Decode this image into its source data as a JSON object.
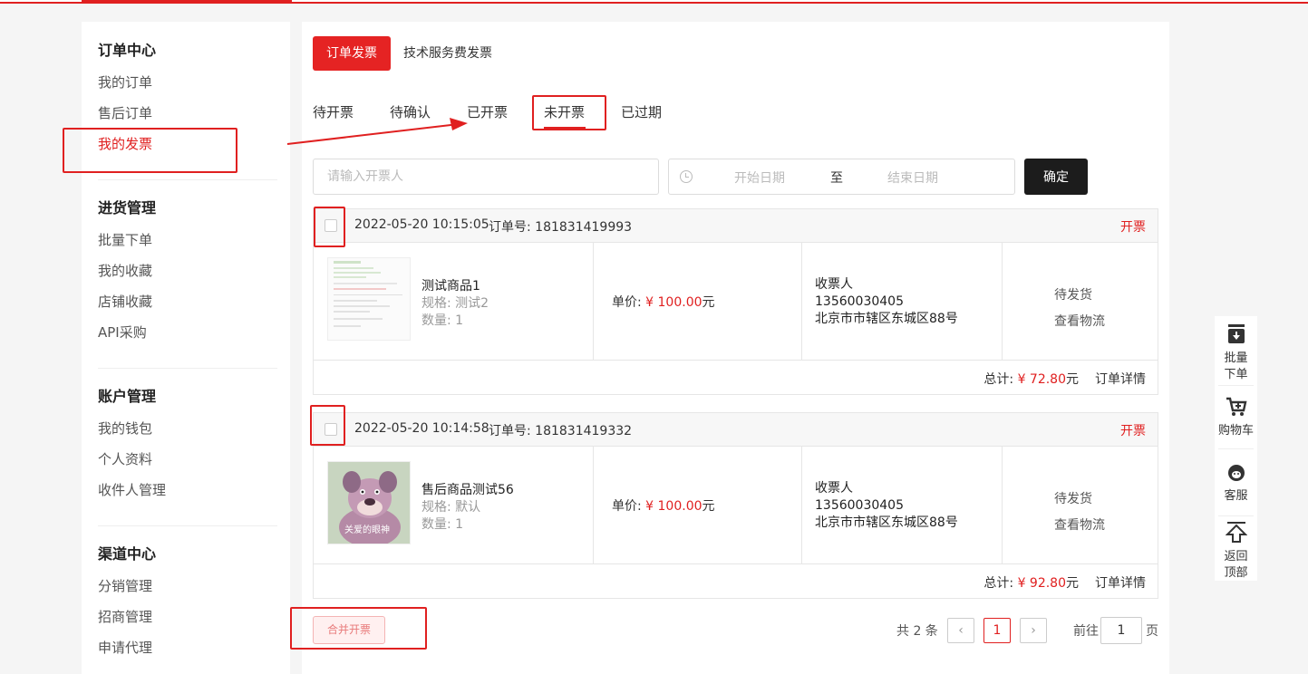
{
  "sidebar": {
    "groups": [
      {
        "title": "订单中心",
        "items": [
          "我的订单",
          "售后订单",
          "我的发票"
        ]
      },
      {
        "title": "进货管理",
        "items": [
          "批量下单",
          "我的收藏",
          "店铺收藏",
          "API采购"
        ]
      },
      {
        "title": "账户管理",
        "items": [
          "我的钱包",
          "个人资料",
          "收件人管理"
        ]
      },
      {
        "title": "渠道中心",
        "items": [
          "分销管理",
          "招商管理",
          "申请代理"
        ]
      }
    ]
  },
  "invoice_tabs": {
    "active": "订单发票",
    "other": "技术服务费发票"
  },
  "status_tabs": [
    "待开票",
    "待确认",
    "已开票",
    "未开票",
    "已过期"
  ],
  "filter": {
    "search_placeholder": "请输入开票人",
    "start_placeholder": "开始日期",
    "range_sep": "至",
    "end_placeholder": "结束日期",
    "confirm_label": "确定"
  },
  "orders": [
    {
      "date": "2022-05-20 10:15:05",
      "order_no": "订单号: 181831419993",
      "action": "开票",
      "product_name": "测试商品1",
      "spec": "规格: 测试2",
      "qty": "数量: 1",
      "unit_price_label": "单价:",
      "unit_price": "¥ 100.00",
      "unit_price_unit": "元",
      "receiver_title": "收票人",
      "receiver_phone": "13560030405",
      "receiver_addr": "北京市市辖区东城区88号",
      "ship_status": "待发货",
      "logistics": "查看物流",
      "total_label": "总计:",
      "total": "¥ 72.80",
      "total_unit": "元",
      "detail": "订单详情"
    },
    {
      "date": "2022-05-20 10:14:58",
      "order_no": "订单号: 181831419332",
      "action": "开票",
      "product_name": "售后商品测试56",
      "spec": "规格: 默认",
      "qty": "数量: 1",
      "unit_price_label": "单价:",
      "unit_price": "¥ 100.00",
      "unit_price_unit": "元",
      "receiver_title": "收票人",
      "receiver_phone": "13560030405",
      "receiver_addr": "北京市市辖区东城区88号",
      "ship_status": "待发货",
      "logistics": "查看物流",
      "total_label": "总计:",
      "total": "¥ 92.80",
      "total_unit": "元",
      "detail": "订单详情",
      "thumb_caption": "关爱的眼神"
    }
  ],
  "footer": {
    "merge_label": "合并开票",
    "total_count": "共 2 条",
    "prev": "‹",
    "current_page": "1",
    "next": "›",
    "goto_label": "前往",
    "goto_value": "1",
    "goto_unit": "页"
  },
  "float_bar": {
    "batch": [
      "批量",
      "下单"
    ],
    "cart": "购物车",
    "service": "客服",
    "back_top": [
      "返回",
      "顶部"
    ]
  },
  "colors": {
    "accent": "#e02020",
    "dark_button": "#1c1c1c"
  }
}
